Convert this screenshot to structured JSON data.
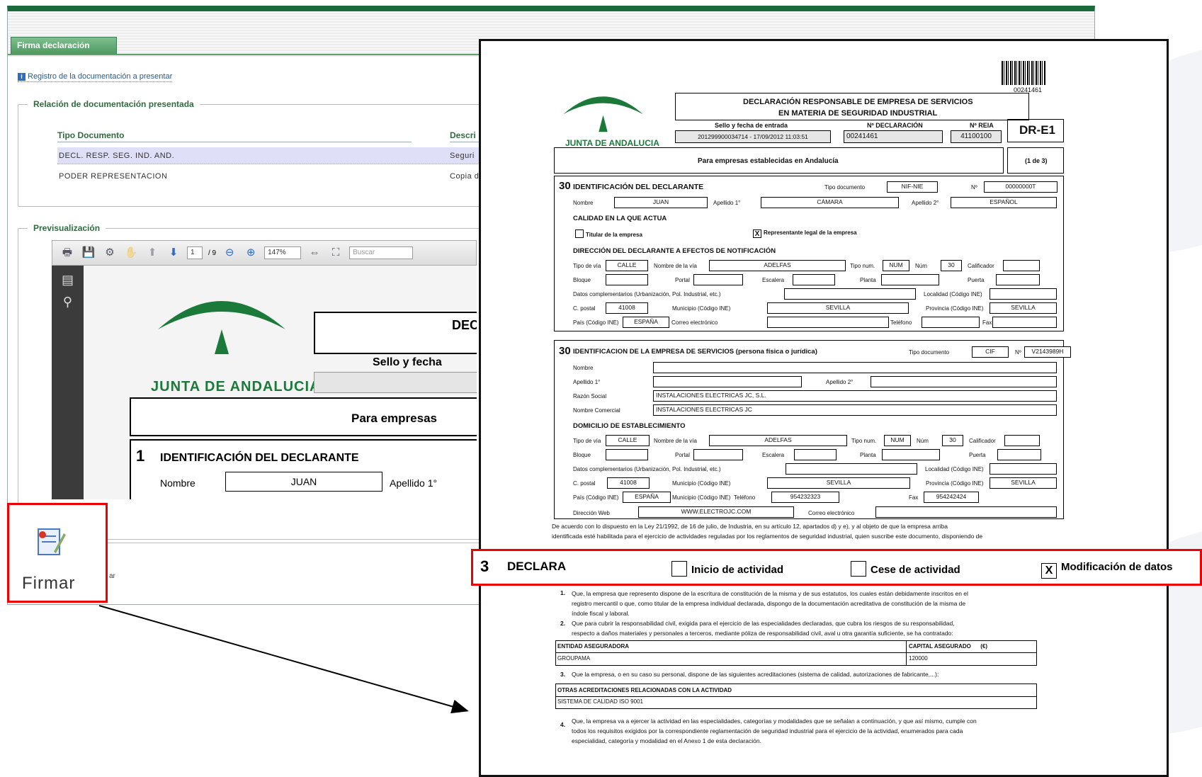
{
  "back_window": {
    "tab_label": "Firma declaración",
    "register_link": "Registro de la documentación a presentar",
    "docs_legend": "Relación de documentación presentada",
    "col_tipo": "Tipo Documento",
    "col_desc": "Descri",
    "rows": [
      {
        "tipo": "DECL. RESP. SEG. IND. AND.",
        "desc": "Seguri"
      },
      {
        "tipo": "PODER REPRESENTACION",
        "desc": "Copia d"
      }
    ],
    "preview_legend": "Previsualización",
    "toolbar": {
      "page_current": "1",
      "page_total": "/ 9",
      "zoom": "147%",
      "search_placeholder": "Buscar"
    },
    "preview": {
      "logo_text": "JUNTA DE ANDALUCIA",
      "title_frag": "DEC",
      "sello_frag": "Sello y fecha",
      "empresas_frag": "Para empresas",
      "sec_num": "1",
      "sec_title": "IDENTIFICACIÓN DEL DECLARANTE",
      "nombre_lbl": "Nombre",
      "nombre_val": "JUAN",
      "ap1_lbl": "Apellido 1°"
    },
    "firmar_label": "Firmar",
    "firmar_suffix": "ar"
  },
  "doc": {
    "barcode_num": "00241461",
    "logo_text": "JUNTA DE ANDALUCIA",
    "title1": "DECLARACIÓN RESPONSABLE DE EMPRESA DE SERVICIOS",
    "title2": "EN MATERIA DE SEGURIDAD INDUSTRIAL",
    "sello_lbl": "Sello y fecha de entrada",
    "ndecl_lbl": "Nº DECLARACIÓN",
    "nreia_lbl": "Nº REIA",
    "sello_val": "201299900034714 - 17/09/2012 11:03:51",
    "ndecl_val": "00241461",
    "nreia_val": "41100100",
    "code": "DR-E1",
    "empresas": "Para empresas establecidas en Andalucía",
    "pages": "(1 de 3)",
    "s1": {
      "num": "30",
      "title": "IDENTIFICACIÓN DEL DECLARANTE",
      "tipo_doc_lbl": "Tipo documento",
      "tipo_doc": "NIF-NIE",
      "n_lbl": "Nº",
      "n_val": "00000000T",
      "nombre_lbl": "Nombre",
      "nombre": "JUAN",
      "ap1_lbl": "Apellido 1°",
      "ap1": "CÁMARA",
      "ap2_lbl": "Apellido 2°",
      "ap2": "ESPAÑOL",
      "calidad": "CALIDAD EN LA QUE ACTUA",
      "titular": "Titular de la empresa",
      "representante": "Representante legal de la empresa",
      "x": "X",
      "direccion": "DIRECCIÓN DEL DECLARANTE A EFECTOS DE NOTIFICACIÓN",
      "tipovia_lbl": "Tipo de vía",
      "tipovia": "CALLE",
      "nomvia_lbl": "Nombre de la vía",
      "nomvia": "ADELFAS",
      "tiponum_lbl": "Tipo num.",
      "tiponum": "NUM",
      "num_lbl": "Núm",
      "calif_lbl": "Calificador",
      "bloque_lbl": "Bloque",
      "portal_lbl": "Portal",
      "escalera_lbl": "Escalera",
      "planta_lbl": "Planta",
      "puerta_lbl": "Puerta",
      "datos_lbl": "Datos complementarios (Urbanización, Pol. Industrial, etc.)",
      "localidad_lbl": "Localidad (Código INE)",
      "cp_lbl": "C. postal",
      "cp": "41008",
      "muni_lbl": "Municipio (Código INE)",
      "muni": "SEVILLA",
      "prov_lbl": "Provincia (Código INE)",
      "prov": "SEVILLA",
      "pais_lbl": "País (Código INE)",
      "pais": "ESPAÑA",
      "correo_lbl": "Correo electrónico",
      "tel_lbl": "Teléfono",
      "fax_lbl": "Fax"
    },
    "s2": {
      "num": "30",
      "title": "IDENTIFICACION DE LA EMPRESA DE SERVICIOS",
      "title_sub": "(persona física o jurídica)",
      "tipo_doc_lbl": "Tipo documento",
      "tipo_doc": "CIF",
      "n_lbl": "Nº",
      "n_val": "V2143989H",
      "nombre_lbl": "Nombre",
      "ap1_lbl": "Apellido 1°",
      "ap2_lbl": "Apellido 2°",
      "razon_lbl": "Razón Social",
      "razon": "INSTALACIONES ELECTRICAS JC, S.L.",
      "comercial_lbl": "Nombre Comercial",
      "comercial": "INSTALACIONES ELECTRICAS JC",
      "domicilio": "DOMICILIO DE ESTABLECIMIENTO",
      "tipovia": "CALLE",
      "nomvia": "ADELFAS",
      "tiponum": "NUM",
      "cp": "41008",
      "muni": "SEVILLA",
      "prov": "SEVILLA",
      "pais": "ESPAÑA",
      "tel": "954232323",
      "fax": "954242424",
      "web_lbl": "Dirección Web",
      "web": "WWW.ELECTROJC.COM",
      "correo_lbl": "Correo electrónico"
    },
    "ley1": "De acuerdo con lo dispuesto en la Ley 21/1992, de 16 de julio, de Industria, en su artículo 12, apartados d) y e), y al objeto de que la empresa arriba",
    "ley2": "identificada esté habilitada para el ejercicio de actividades reguladas por los reglamentos de seguridad industrial, quien suscribe este documento, disponiendo de",
    "p1a": "Que, la empresa que represento dispone de la escritura de constitución de la misma y de sus estatutos, los cuales están debidamente inscritos en el",
    "p1b": "registro mercantil o que, como titular de la empresa individual declarada, dispongo de la documentación acreditativa de constitución de la misma de",
    "p1c": "índole fiscal y laboral.",
    "p2a": "Que para cubrir la responsabilidad civil, exigida para el ejercicio de las especialidades declaradas, que cubra los riesgos de su responsabilidad,",
    "p2b": "respecto a daños materiales y personales a terceros, mediante póliza de responsabilidad civil, aval u otra garantía suficiente, se ha contratado:",
    "ent_lbl": "ENTIDAD ASEGURADORA",
    "ent_val": "GROUPAMA",
    "cap_lbl": "CAPITAL ASEGURADO",
    "cap_unit": "(€)",
    "cap_val": "120000",
    "p3": "Que la empresa, o en su caso su personal, dispone de las siguientes acreditaciones (sistema de calidad, autorizaciones de fabricante,...):",
    "otras_lbl": "OTRAS ACREDITACIONES RELACIONADAS CON LA ACTIVIDAD",
    "otras_val": "SISTEMA DE CALIDAD ISO 9001",
    "p4a": "Que, la empresa va a ejercer la actividad en las especialidades, categorías y modalidades que se señalan a continuación, y que así mismo, cumple con",
    "p4b": "todos los requisitos exigidos por la correspondiente reglamentación de seguridad industrial para el ejercicio de la actividad, enumerados para cada",
    "p4c": "especialidad, categoría y modalidad en el Anexo 1 de esta declaración.",
    "n1": "1.",
    "n2": "2.",
    "n3": "3.",
    "n4": "4."
  },
  "declara": {
    "num": "3",
    "title": "DECLARA",
    "inicio": "Inicio de actividad",
    "cese": "Cese de actividad",
    "modif": "Modificación de datos",
    "x": "X"
  }
}
